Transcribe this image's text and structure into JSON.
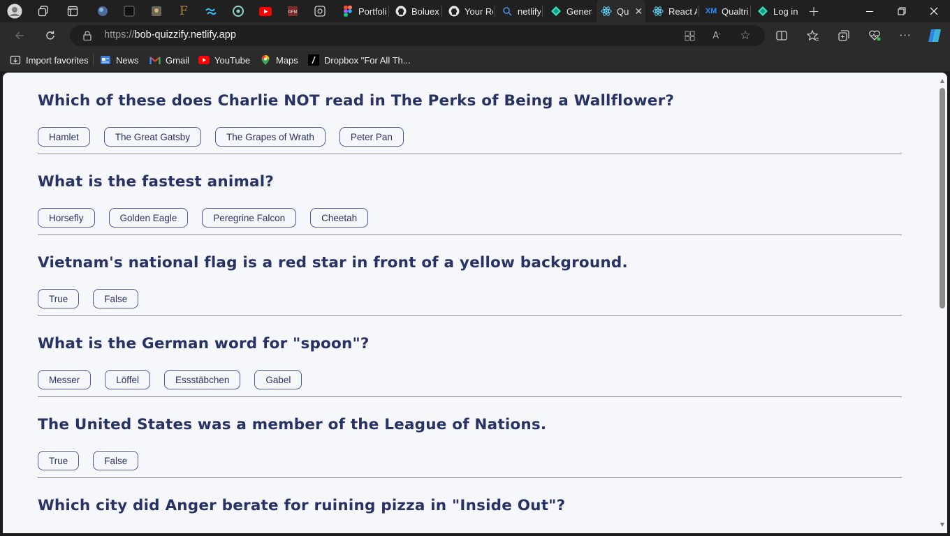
{
  "browser": {
    "tabs": [
      {
        "label": "Portfoli",
        "icon": "figma-icon"
      },
      {
        "label": "Boluex",
        "icon": "github-icon"
      },
      {
        "label": "Your Re",
        "icon": "github-icon"
      },
      {
        "label": "netlify",
        "icon": "search-icon"
      },
      {
        "label": "Genera",
        "icon": "netlify-icon"
      },
      {
        "label": "Qu",
        "icon": "react-icon",
        "active": true
      },
      {
        "label": "React A",
        "icon": "react-icon"
      },
      {
        "label": "Qualtri",
        "icon": "xm-icon"
      },
      {
        "label": "Log in",
        "icon": "netlify-icon"
      }
    ],
    "url_scheme": "https://",
    "url_host": "bob-quizzify.netlify.app",
    "favorites": [
      {
        "label": "Import favorites",
        "icon": "import-favorites-icon"
      },
      {
        "label": "News",
        "icon": "news-icon"
      },
      {
        "label": "Gmail",
        "icon": "gmail-icon"
      },
      {
        "label": "YouTube",
        "icon": "youtube-icon"
      },
      {
        "label": "Maps",
        "icon": "maps-icon"
      },
      {
        "label": "Dropbox \"For All Th...",
        "icon": "dropbox-icon"
      }
    ]
  },
  "quiz": {
    "questions": [
      {
        "text": "Which of these does Charlie NOT read in The Perks of Being a Wallflower?",
        "answers": [
          "Hamlet",
          "The Great Gatsby",
          "The Grapes of Wrath",
          "Peter Pan"
        ]
      },
      {
        "text": "What is the fastest animal?",
        "answers": [
          "Horsefly",
          "Golden Eagle",
          "Peregrine Falcon",
          "Cheetah"
        ]
      },
      {
        "text": "Vietnam's national flag is a red star in front of a yellow background.",
        "answers": [
          "True",
          "False"
        ]
      },
      {
        "text": "What is the German word for \"spoon\"?",
        "answers": [
          "Messer",
          "Löffel",
          "Essstäbchen",
          "Gabel"
        ]
      },
      {
        "text": "The United States was a member of the League of Nations.",
        "answers": [
          "True",
          "False"
        ]
      },
      {
        "text": "Which city did Anger berate for ruining pizza in \"Inside Out\"?",
        "answers": []
      }
    ]
  },
  "colors": {
    "page_background": "#f5f7fb",
    "question_text": "#293264",
    "answer_border": "#4d5b9e",
    "browser_chrome": "#202020"
  }
}
